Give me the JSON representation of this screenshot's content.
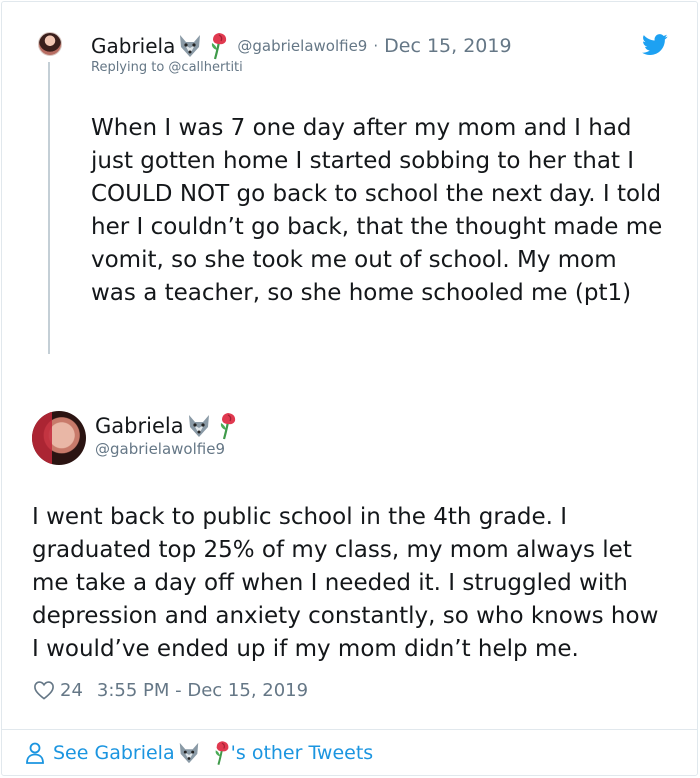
{
  "reply_tweet": {
    "name": "Gabriela",
    "name_emojis": [
      "wolf-icon",
      "rose-icon"
    ],
    "handle": "@gabrielawolfie9",
    "separator": "·",
    "date": "Dec 15, 2019",
    "replying_to": "Replying to @callhertiti",
    "text": "When I was 7 one day after my mom and I had just gotten home I started sobbing to her that I COULD NOT go back to school the next day. I told her I couldn’t go back, that the thought made me vomit, so she took me out of school. My mom was a teacher, so she home schooled me (pt1)"
  },
  "main_tweet": {
    "name": "Gabriela",
    "name_emojis": [
      "wolf-icon",
      "rose-icon"
    ],
    "handle": "@gabrielawolfie9",
    "text": "I went back to public school in the 4th grade. I graduated top 25% of my class, my mom always let me take a day off when I needed it. I struggled with depression and anxiety constantly, so who knows how I would’ve ended up if my mom didn’t help me.",
    "likes": "24",
    "timestamp": "3:55 PM - Dec 15, 2019"
  },
  "footer": {
    "prefix": "See Gabriela",
    "suffix": "'s other Tweets",
    "icon": "person-icon"
  },
  "colors": {
    "text": "#14171a",
    "secondary": "#657786",
    "link": "#1b95e0",
    "twitter_blue": "#1da1f2",
    "border": "#e1e8ed"
  }
}
